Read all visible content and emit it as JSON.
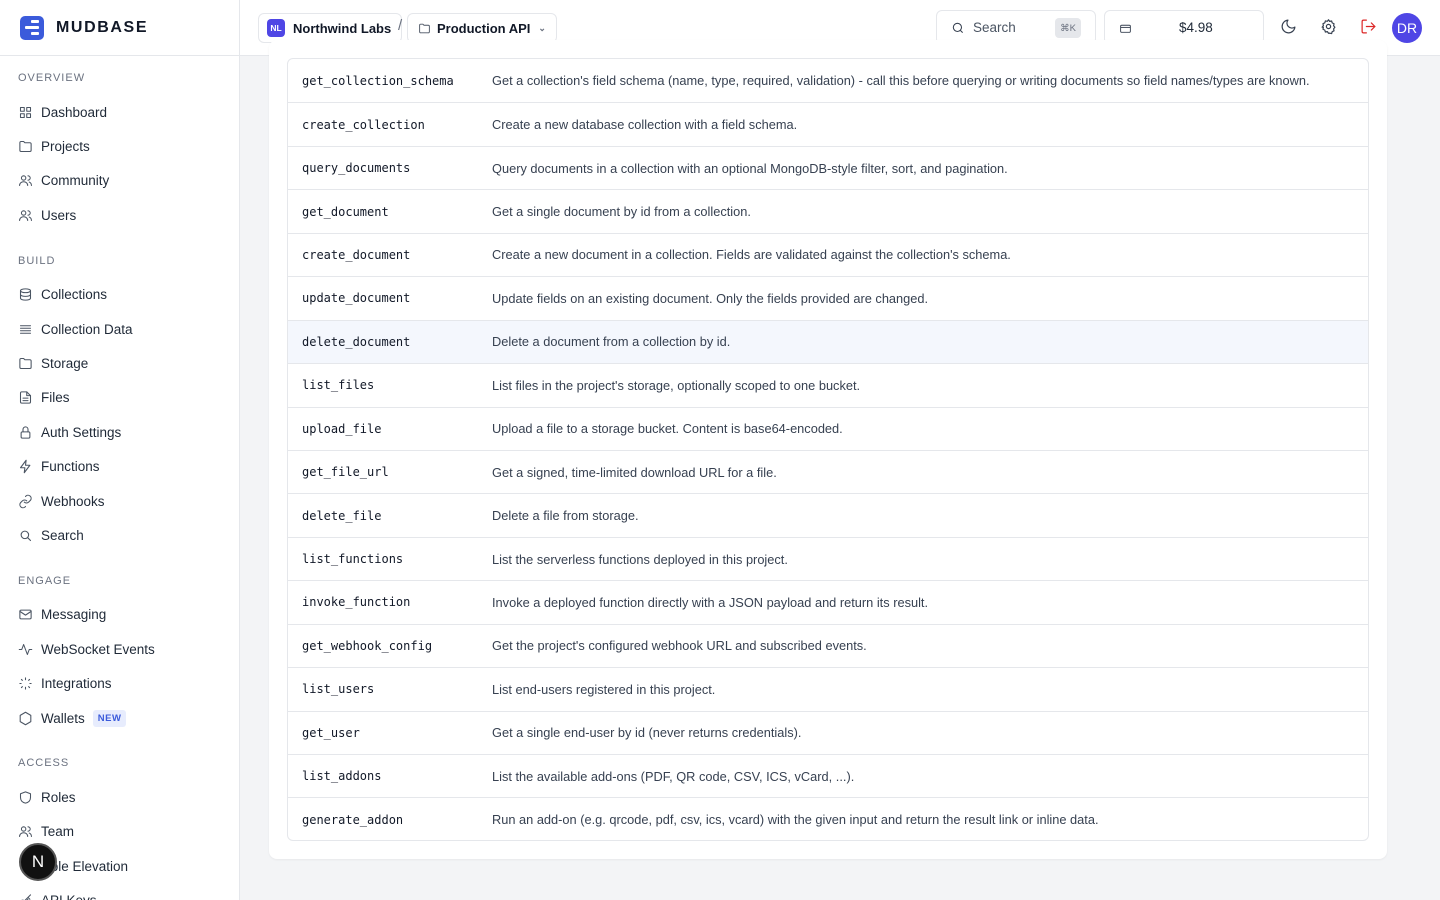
{
  "brand": {
    "name": "MUDBASE"
  },
  "sidebar": {
    "sections": [
      {
        "title": "OVERVIEW",
        "items": [
          {
            "label": "Dashboard",
            "icon": "grid"
          },
          {
            "label": "Projects",
            "icon": "folder"
          },
          {
            "label": "Community",
            "icon": "users"
          },
          {
            "label": "Users",
            "icon": "users"
          }
        ]
      },
      {
        "title": "BUILD",
        "items": [
          {
            "label": "Collections",
            "icon": "database"
          },
          {
            "label": "Collection Data",
            "icon": "list"
          },
          {
            "label": "Storage",
            "icon": "folder"
          },
          {
            "label": "Files",
            "icon": "file"
          },
          {
            "label": "Auth Settings",
            "icon": "lock"
          },
          {
            "label": "Functions",
            "icon": "zap"
          },
          {
            "label": "Webhooks",
            "icon": "link"
          },
          {
            "label": "Search",
            "icon": "search"
          }
        ]
      },
      {
        "title": "ENGAGE",
        "items": [
          {
            "label": "Messaging",
            "icon": "mail"
          },
          {
            "label": "WebSocket Events",
            "icon": "activity"
          },
          {
            "label": "Integrations",
            "icon": "sparkle"
          },
          {
            "label": "Wallets",
            "icon": "hexagon",
            "badge": "NEW"
          }
        ]
      },
      {
        "title": "ACCESS",
        "items": [
          {
            "label": "Roles",
            "icon": "shield"
          },
          {
            "label": "Team",
            "icon": "users"
          },
          {
            "label": "Role Elevation",
            "icon": "shield"
          },
          {
            "label": "API Keys",
            "icon": "key"
          }
        ]
      }
    ],
    "fab_label": "N"
  },
  "topbar": {
    "org": {
      "initials": "NL",
      "name": "Northwind Labs"
    },
    "separator": "/",
    "project": {
      "name": "Production API"
    },
    "search": {
      "label": "Search",
      "shortcut": "⌘K"
    },
    "credits": "$4.98",
    "user_initials": "DR"
  },
  "tools": [
    {
      "name": "get_collection_schema",
      "description": "Get a collection's field schema (name, type, required, validation) - call this before querying or writing documents so field names/types are known."
    },
    {
      "name": "create_collection",
      "description": "Create a new database collection with a field schema."
    },
    {
      "name": "query_documents",
      "description": "Query documents in a collection with an optional MongoDB-style filter, sort, and pagination."
    },
    {
      "name": "get_document",
      "description": "Get a single document by id from a collection."
    },
    {
      "name": "create_document",
      "description": "Create a new document in a collection. Fields are validated against the collection's schema."
    },
    {
      "name": "update_document",
      "description": "Update fields on an existing document. Only the fields provided are changed."
    },
    {
      "name": "delete_document",
      "description": "Delete a document from a collection by id.",
      "highlighted": true
    },
    {
      "name": "list_files",
      "description": "List files in the project's storage, optionally scoped to one bucket."
    },
    {
      "name": "upload_file",
      "description": "Upload a file to a storage bucket. Content is base64-encoded."
    },
    {
      "name": "get_file_url",
      "description": "Get a signed, time-limited download URL for a file."
    },
    {
      "name": "delete_file",
      "description": "Delete a file from storage."
    },
    {
      "name": "list_functions",
      "description": "List the serverless functions deployed in this project."
    },
    {
      "name": "invoke_function",
      "description": "Invoke a deployed function directly with a JSON payload and return its result."
    },
    {
      "name": "get_webhook_config",
      "description": "Get the project's configured webhook URL and subscribed events."
    },
    {
      "name": "list_users",
      "description": "List end-users registered in this project."
    },
    {
      "name": "get_user",
      "description": "Get a single end-user by id (never returns credentials)."
    },
    {
      "name": "list_addons",
      "description": "List the available add-ons (PDF, QR code, CSV, ICS, vCard, ...)."
    },
    {
      "name": "generate_addon",
      "description": "Run an add-on (e.g. qrcode, pdf, csv, ics, vcard) with the given input and return the result link or inline data."
    }
  ]
}
